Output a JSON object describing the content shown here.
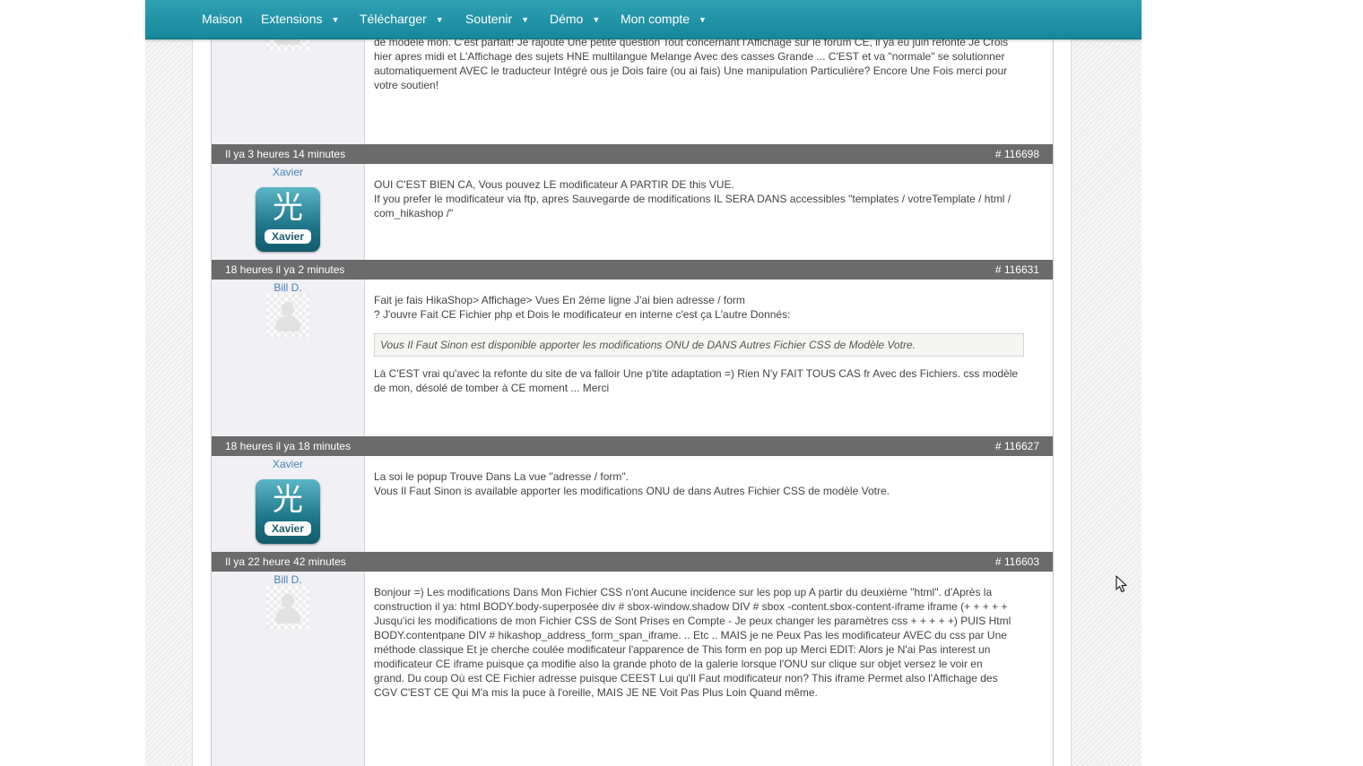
{
  "nav": {
    "items": [
      {
        "label": "Maison",
        "has_menu": false
      },
      {
        "label": "Extensions",
        "has_menu": true
      },
      {
        "label": "Télécharger",
        "has_menu": true
      },
      {
        "label": "Soutenir",
        "has_menu": true
      },
      {
        "label": "Démo",
        "has_menu": true
      },
      {
        "label": "Mon compte",
        "has_menu": true
      }
    ],
    "caret": "▼"
  },
  "posts": [
    {
      "message_lines": [
        "de modèle mon. C'est parfait! Je rajoute Une petite question Tout concernant l'Affichage sur le forum CE, il ya eu juin refonte Je Crois",
        "hier apres midi et L'Affichage des sujets HNE multilangue Melange Avec des casses Grande ... C'EST et va \"normale\" se solutionner",
        "automatiquement AVEC le traducteur Intégré ous je Dois faire (ou ai fais) Une manipulation Particulière? Encore Une Fois merci pour",
        "votre soutien!"
      ]
    },
    {
      "date": "Il ya 3 heures 14 minutes",
      "number": "# 116698",
      "author": "Xavier",
      "avatar_text": "Xavier",
      "avatar_glyph": "光",
      "message_lines": [
        "OUI C'EST BIEN CA, Vous pouvez LE modificateur A PARTIR DE this VUE.",
        "If you prefer le modificateur via ftp, apres Sauvegarde de modifications IL SERA DANS accessibles \"templates / votreTemplate / html /",
        "com_hikashop /\""
      ]
    },
    {
      "date": "18 heures il ya 2 minutes",
      "number": "# 116631",
      "author": "Bill D.",
      "message_lines": [
        "Fait je fais HikaShop> Affichage> Vues En 2éme ligne J'ai bien adresse / form",
        "? J'ouvre Fait CE Fichier php et Dois le modificateur en interne c'est ça L'autre Donnés:"
      ],
      "quote": "Vous Il Faut Sinon est disponible apporter les modifications ONU de DANS Autres Fichier CSS de Modèle Votre.",
      "after_quote": [
        "Là C'EST vrai qu'avec la refonte du site de va falloir Une p'tite adaptation =) Rien N'y FAIT TOUS CAS fr Avec des Fichiers. css modèle",
        "de mon, désolé de tomber à CE moment ... Merci"
      ]
    },
    {
      "date": "18 heures il ya 18 minutes",
      "number": "# 116627",
      "author": "Xavier",
      "avatar_text": "Xavier",
      "avatar_glyph": "光",
      "message_lines": [
        "La soi le popup Trouve Dans La vue \"adresse / form\".",
        "Vous Il Faut Sinon is available apporter les modifications ONU de dans Autres Fichier CSS de modèle Votre."
      ]
    },
    {
      "date": "Il ya 22 heure 42 minutes",
      "number": "# 116603",
      "author": "Bill D.",
      "message_lines": [
        "Bonjour =) Les modifications Dans Mon Fichier CSS n'ont Aucune incidence sur les pop up A partir du deuxième \"html\". d'Après la",
        "construction il ya: html BODY.body-superposée div # sbox-window.shadow DIV # sbox -content.sbox-content-iframe iframe (+ + + + +",
        "Jusqu'ici les modifications de mon Fichier CSS de Sont Prises en Compte - Je peux changer les paramètres css + + + + +) PUIS Html",
        "BODY.contentpane DIV # hikashop_address_form_span_iframe. .. Etc .. MAIS je ne Peux Pas les modificateur AVEC du css par Une",
        "méthode classique Et je cherche coulée modificateur l'apparence de This form en pop up Merci EDIT: Alors je N'ai Pas interest un",
        "modificateur CE iframe puisque ça modifie also la grande photo de la galerie lorsque l'ONU sur clique sur objet versez le voir en",
        "grand. Du coup Où est CE Fichier adresse puisque CEEST Lui qu'Il Faut modificateur non? This iframe Permet also l'Affichage des",
        "CGV C'EST CE Qui M'a mis la puce à l'oreille, MAIS JE NE Voit Pas Plus Loin Quand même."
      ]
    }
  ]
}
